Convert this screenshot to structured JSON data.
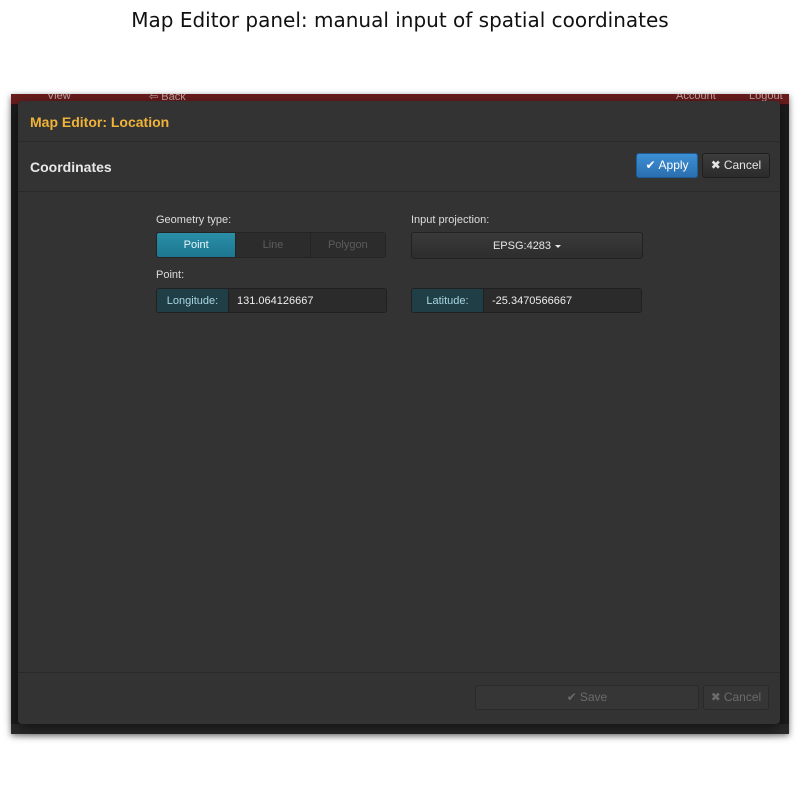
{
  "caption": "Map Editor panel: manual input of spatial coordinates",
  "background_app": {
    "nav_view": "View",
    "nav_back": "Back",
    "nav_account": "Account",
    "nav_logout": "Logout"
  },
  "modal": {
    "title": "Map Editor: Location",
    "section_title": "Coordinates",
    "apply_label": "Apply",
    "cancel_label": "Cancel",
    "geometry_type_label": "Geometry type:",
    "geometry_types": [
      "Point",
      "Line",
      "Polygon"
    ],
    "selected_geometry": "Point",
    "input_projection_label": "Input projection:",
    "projection_value": "EPSG:4283",
    "point_label": "Point:",
    "longitude_label": "Longitude:",
    "longitude_value": "131.064126667",
    "latitude_label": "Latitude:",
    "latitude_value": "-25.3470566667",
    "footer_save_label": "Save",
    "footer_cancel_label": "Cancel"
  },
  "colors": {
    "title_accent": "#f0b33a",
    "apply_blue": "#2a6fb0",
    "segment_active": "#1d7790",
    "addon_bg": "#1f3e46"
  }
}
